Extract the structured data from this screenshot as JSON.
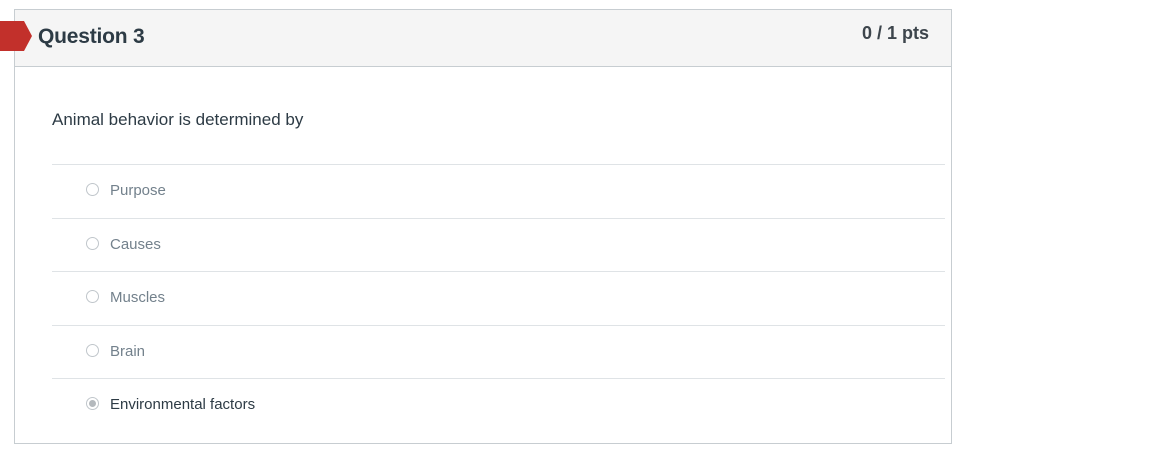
{
  "question": {
    "title": "Question 3",
    "points": "0 / 1 pts",
    "text": "Animal behavior is determined by",
    "status_flag_color": "#c2302b"
  },
  "answers": [
    {
      "label": "Purpose",
      "selected": false
    },
    {
      "label": "Causes",
      "selected": false
    },
    {
      "label": "Muscles",
      "selected": false
    },
    {
      "label": "Brain",
      "selected": false
    },
    {
      "label": "Environmental factors",
      "selected": true
    }
  ]
}
